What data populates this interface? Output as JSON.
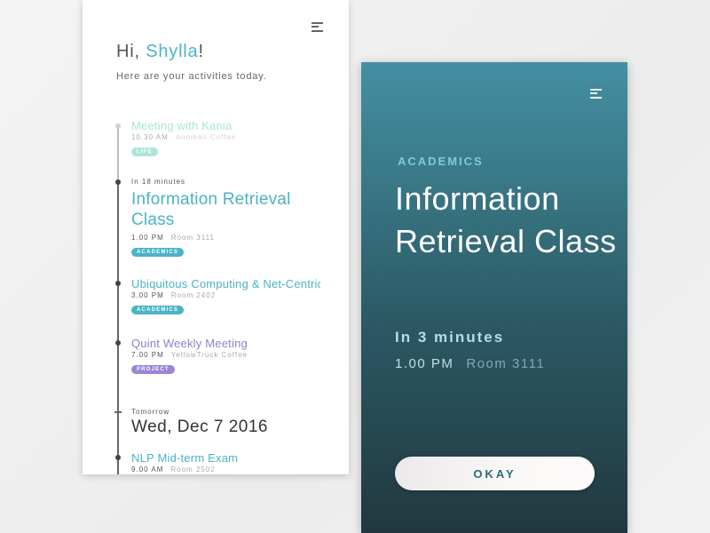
{
  "colors": {
    "accent_teal": "#4bb3c8",
    "life_green": "#7fd6c4",
    "project_purple": "#9a86d6",
    "okay_text": "#2f6a7a"
  },
  "left_card": {
    "greeting_prefix": "Hi, ",
    "user_name": "Shylla",
    "greeting_suffix": "!",
    "subtitle": "Here are your activities today.",
    "menu_icon": "hamburger-menu-icon",
    "events": [
      {
        "title": "Meeting with Kania",
        "time": "10.30 AM",
        "place": "Anomali Coffee",
        "tag": "LIFE",
        "state": "past"
      },
      {
        "label": "In 18 minutes",
        "title": "Information Retrieval Class",
        "time": "1.00 PM",
        "place": "Room 3111",
        "tag": "ACADEMICS",
        "state": "upcoming"
      },
      {
        "title": "Ubiquitous Computing & Net-Centric",
        "time": "3.00 PM",
        "place": "Room 2402",
        "tag": "ACADEMICS",
        "state": "later"
      },
      {
        "title": "Quint Weekly Meeting",
        "time": "7.00 PM",
        "place": "YellowTruck Coffee",
        "tag": "PROJECT",
        "state": "later"
      }
    ],
    "tomorrow": {
      "label": "Tomorrow",
      "date": "Wed, Dec 7 2016",
      "events": [
        {
          "title": "NLP Mid-term Exam",
          "time": "9.00 AM",
          "place": "Room 2502"
        }
      ]
    }
  },
  "right_card": {
    "menu_icon": "hamburger-menu-icon",
    "category": "ACADEMICS",
    "title": "Information Retrieval Class",
    "countdown": "In 3 minutes",
    "time": "1.00 PM",
    "place": "Room 3111",
    "button_label": "OKAY"
  }
}
